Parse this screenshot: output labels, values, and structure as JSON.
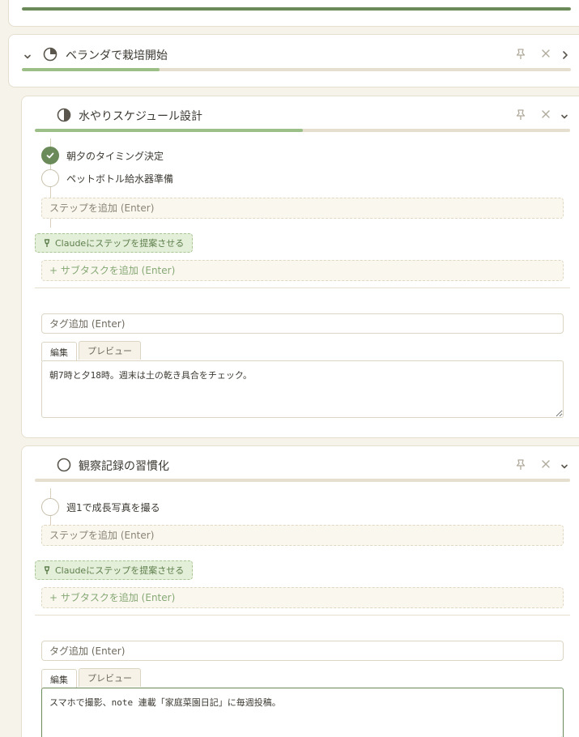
{
  "top_card": {
    "progress": 1.0
  },
  "veranda": {
    "title": "ベランダで栽培開始",
    "progress": 0.25
  },
  "watering": {
    "title": "水やりスケジュール設計",
    "progress": 0.5,
    "steps": [
      {
        "label": "朝夕のタイミング決定",
        "done": true
      },
      {
        "label": "ペットボトル給水器準備",
        "done": false
      }
    ],
    "step_placeholder": "ステップを追加 (Enter)",
    "suggest_label": "Claudeにステップを提案させる",
    "subtask_placeholder": "+ サブタスクを追加 (Enter)",
    "tag_placeholder": "タグ追加 (Enter)",
    "tab_edit": "編集",
    "tab_preview": "プレビュー",
    "notes": "朝7時と夕18時。週末は土の乾き具合をチェック。"
  },
  "observation": {
    "title": "観察記録の習慣化",
    "progress": 0.0,
    "steps": [
      {
        "label": "週1で成長写真を撮る",
        "done": false
      }
    ],
    "step_placeholder": "ステップを追加 (Enter)",
    "suggest_label": "Claudeにステップを提案させる",
    "subtask_placeholder": "+ サブタスクを追加 (Enter)",
    "tag_placeholder": "タグ追加 (Enter)",
    "tab_edit": "編集",
    "tab_preview": "プレビュー",
    "notes": "スマホで撮影、note 連載「家庭菜園日記」に毎週投稿。"
  },
  "icons": {
    "pin": "pin-icon",
    "close": "close-icon",
    "expand": "chevron-right-icon",
    "collapse": "chevron-down-icon",
    "status": "progress-pie-icon",
    "check": "check-icon",
    "lightbulb": "lightbulb-icon"
  },
  "colors": {
    "accent": "#6b8a5a",
    "progress_light": "#9bbf86",
    "track": "#e6dfcf",
    "suggest_bg": "#e4efd9"
  }
}
